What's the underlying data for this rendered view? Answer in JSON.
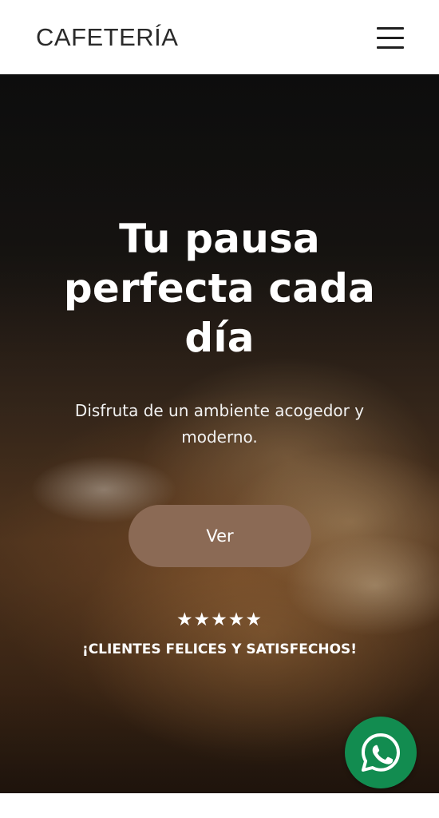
{
  "header": {
    "brand": "CAFETERÍA",
    "menu_icon": "hamburger-menu-icon"
  },
  "hero": {
    "title": "Tu pausa perfecta cada día",
    "subtitle": "Disfruta de un ambiente acogedor y moderno.",
    "cta_label": "Ver",
    "rating_stars": "★★★★★",
    "rating_value": 5,
    "rating_max": 5,
    "tagline": "¡CLIENTES FELICES Y SATISFECHOS!"
  },
  "floating": {
    "whatsapp_icon": "whatsapp-icon"
  },
  "colors": {
    "cta_background": "#8b6a55",
    "whatsapp_green": "#128c50",
    "header_background": "#ffffff"
  }
}
